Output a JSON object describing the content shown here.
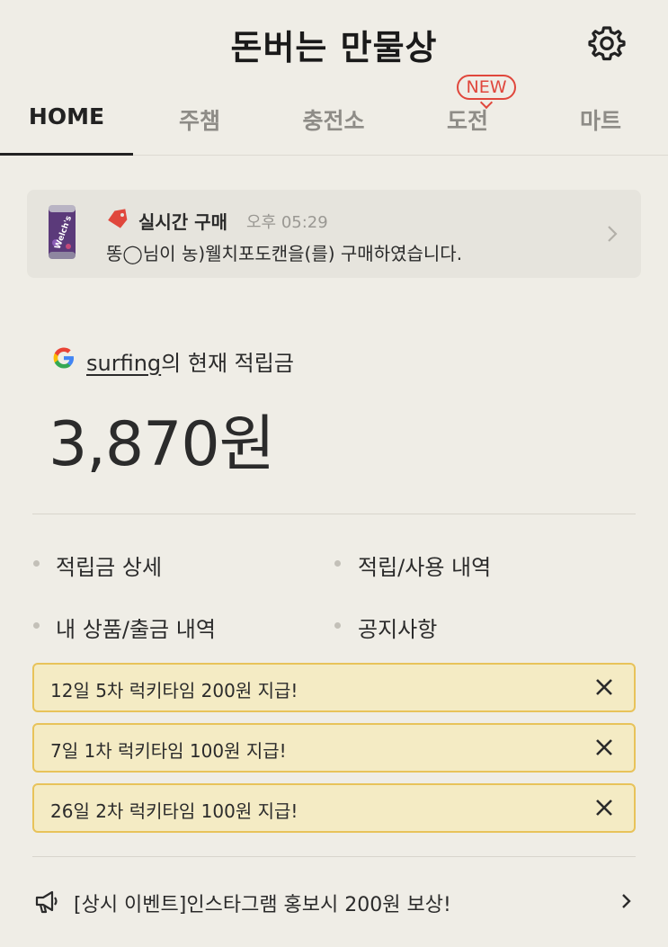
{
  "header": {
    "title": "돈버는 만물상",
    "settings_icon": "gear-icon"
  },
  "tabs": [
    {
      "label": "HOME",
      "active": true
    },
    {
      "label": "주챔",
      "active": false
    },
    {
      "label": "충전소",
      "active": false
    },
    {
      "label": "도전",
      "active": false,
      "badge": "NEW"
    },
    {
      "label": "마트",
      "active": false
    }
  ],
  "live_purchase": {
    "title": "실시간 구매",
    "time": "오후 05:29",
    "message": "똥◯님이 농)웰치포도캔을(를) 구매하였습니다.",
    "thumb_text": "Welch's"
  },
  "balance": {
    "username": "surfing",
    "label_suffix": "의 현재 적립금",
    "amount": "3,870원"
  },
  "menu": [
    {
      "label": "적립금 상세"
    },
    {
      "label": "적립/사용 내역"
    },
    {
      "label": "내 상품/출금 내역"
    },
    {
      "label": "공지사항"
    }
  ],
  "notices": [
    {
      "text": "12일 5차 럭키타임 200원 지급!"
    },
    {
      "text": "7일 1차 럭키타임 100원 지급!"
    },
    {
      "text": "26일 2차 럭키타임 100원 지급!"
    }
  ],
  "event": {
    "text": "[상시 이벤트]인스타그램 홍보시 200원 보상!"
  },
  "colors": {
    "background": "#efede6",
    "notice_bg": "#f4ebc4",
    "notice_border": "#e8c35a",
    "badge_red": "#e0473c"
  }
}
